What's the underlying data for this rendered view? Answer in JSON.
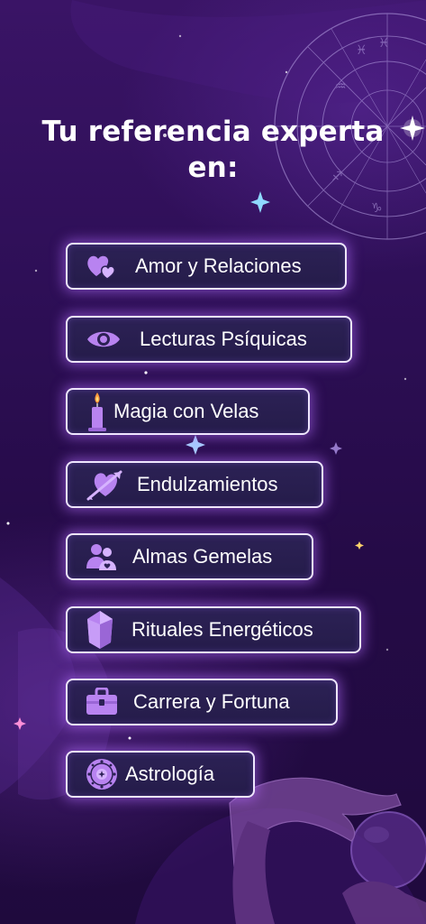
{
  "title": {
    "line1": "Tu referencia experta",
    "line2": "en:"
  },
  "colors": {
    "background_top": "#3a1466",
    "background_bottom": "#1f0a3d",
    "button_border": "#efe6ff",
    "button_fill": "#2c2155",
    "button_glow": "#b46eff",
    "icon_accent": "#b883f0"
  },
  "menu": [
    {
      "id": "amor",
      "label": "Amor y Relaciones",
      "icon": "hearts-icon"
    },
    {
      "id": "lecturas",
      "label": "Lecturas Psíquicas",
      "icon": "eye-icon"
    },
    {
      "id": "magia",
      "label": "Magia con Velas",
      "icon": "candle-icon"
    },
    {
      "id": "endulzamientos",
      "label": "Endulzamientos",
      "icon": "heart-arrow-icon"
    },
    {
      "id": "almas",
      "label": "Almas Gemelas",
      "icon": "couple-icon"
    },
    {
      "id": "rituales",
      "label": "Rituales Energéticos",
      "icon": "crystal-icon"
    },
    {
      "id": "carrera",
      "label": "Carrera y Fortuna",
      "icon": "briefcase-icon"
    },
    {
      "id": "astrologia",
      "label": "Astrología",
      "icon": "zodiac-wheel-icon"
    }
  ]
}
